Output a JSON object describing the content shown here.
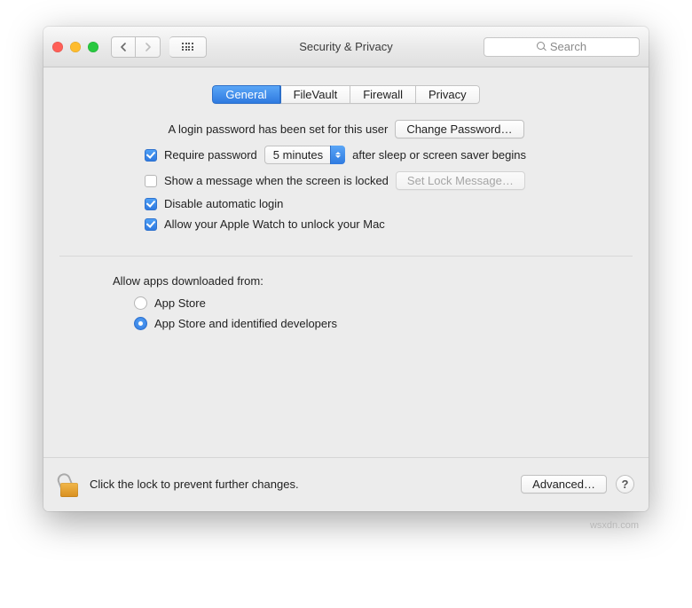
{
  "window": {
    "title": "Security & Privacy"
  },
  "toolbar": {
    "search_placeholder": "Search"
  },
  "tabs": [
    {
      "label": "General",
      "active": true
    },
    {
      "label": "FileVault",
      "active": false
    },
    {
      "label": "Firewall",
      "active": false
    },
    {
      "label": "Privacy",
      "active": false
    }
  ],
  "login": {
    "password_set_text": "A login password has been set for this user",
    "change_password_label": "Change Password…",
    "require_password_label": "Require password",
    "require_password_delay": "5 minutes",
    "require_password_suffix": "after sleep or screen saver begins",
    "show_message_label": "Show a message when the screen is locked",
    "set_lock_message_label": "Set Lock Message…",
    "disable_auto_login_label": "Disable automatic login",
    "apple_watch_label": "Allow your Apple Watch to unlock your Mac",
    "checks": {
      "require_password": true,
      "show_message": false,
      "disable_auto_login": true,
      "apple_watch": true
    }
  },
  "downloads": {
    "section_label": "Allow apps downloaded from:",
    "options": [
      {
        "label": "App Store",
        "selected": false
      },
      {
        "label": "App Store and identified developers",
        "selected": true
      }
    ]
  },
  "footer": {
    "lock_text": "Click the lock to prevent further changes.",
    "advanced_label": "Advanced…",
    "help_label": "?"
  },
  "watermark": "wsxdn.com"
}
